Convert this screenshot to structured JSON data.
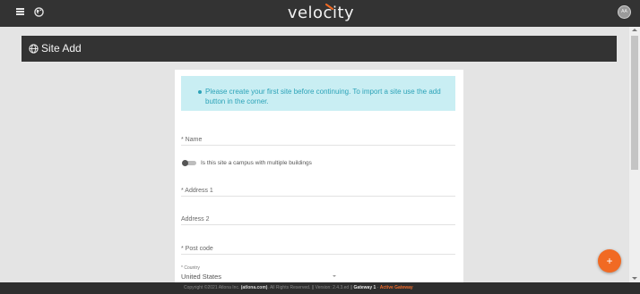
{
  "app": {
    "logo_text": "velocity",
    "avatar_initials": "AA",
    "accent_color": "#f16a23",
    "menu_icon": "hamburger-menu-icon",
    "globe_icon": "globe-icon"
  },
  "header": {
    "title": "Site Add",
    "icon": "globe-icon"
  },
  "form": {
    "alert_text": "Please create your first site before continuing. To import a site use the add button in the corner.",
    "name_label": "* Name",
    "campus_toggle_label": "Is this site a campus with multiple buildings",
    "campus_toggle_on": false,
    "address1_label": "* Address 1",
    "address2_label": "Address 2",
    "postcode_label": "* Post code",
    "country_label": "* Country",
    "country_value": "United States"
  },
  "fab": {
    "label": "+"
  },
  "footer": {
    "copyright": "Copyright ©2021 Atlona Inc.",
    "link": "(atlona.com)",
    "rights": ". All Rights Reserved. || Version: 2.4.3.ed || ",
    "gateway_label": "Gateway 1",
    "separator": " - ",
    "gateway_status": "Active Gateway"
  }
}
